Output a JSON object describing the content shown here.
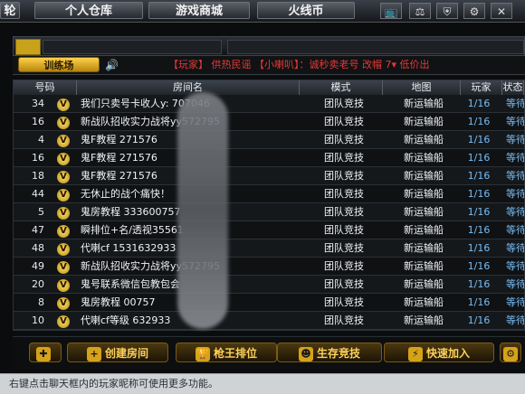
{
  "top": {
    "left_fragment": "轮",
    "tabs": [
      "个人仓库",
      "游戏商城",
      "火线币"
    ],
    "icons": [
      "tv-icon",
      "scale-icon",
      "shield-icon",
      "settings-icon",
      "close-icon"
    ]
  },
  "mode": {
    "button_label": "训练场",
    "marquee": "【玩家】 供热民谣 【小喇叭】：诚秒卖老号  改帽  7▾  低价出"
  },
  "table": {
    "headers": [
      "号码",
      "房间名",
      "模式",
      "地图",
      "玩家",
      "状态"
    ],
    "rows": [
      {
        "num": "34",
        "name": "我们只卖号卡收人y: 707046",
        "mode": "团队竞技",
        "map": "新运输船",
        "players": "1/16",
        "state": "等待"
      },
      {
        "num": "16",
        "name": "新战队招收实力战将yy572795",
        "mode": "团队竞技",
        "map": "新运输船",
        "players": "1/16",
        "state": "等待"
      },
      {
        "num": "4",
        "name": "鬼F教程 271576",
        "mode": "团队竞技",
        "map": "新运输船",
        "players": "1/16",
        "state": "等待"
      },
      {
        "num": "16",
        "name": "鬼F教程 271576",
        "mode": "团队竞技",
        "map": "新运输船",
        "players": "1/16",
        "state": "等待"
      },
      {
        "num": "18",
        "name": "鬼F教程 271576",
        "mode": "团队竞技",
        "map": "新运输船",
        "players": "1/16",
        "state": "等待"
      },
      {
        "num": "44",
        "name": "无休止的战个痛快！",
        "mode": "团队竞技",
        "map": "新运输船",
        "players": "1/16",
        "state": "等待"
      },
      {
        "num": "5",
        "name": "鬼房教程 333600757",
        "mode": "团队竞技",
        "map": "新运输船",
        "players": "1/16",
        "state": "等待"
      },
      {
        "num": "47",
        "name": "瞬排位+名/透视35561",
        "mode": "团队竞技",
        "map": "新运输船",
        "players": "1/16",
        "state": "等待"
      },
      {
        "num": "48",
        "name": "代喇cf 1531632933",
        "mode": "团队竞技",
        "map": "新运输船",
        "players": "1/16",
        "state": "等待"
      },
      {
        "num": "49",
        "name": "新战队招收实力战将yy572795",
        "mode": "团队竞技",
        "map": "新运输船",
        "players": "1/16",
        "state": "等待"
      },
      {
        "num": "20",
        "name": "鬼号联系微信包教包会",
        "mode": "团队竞技",
        "map": "新运输船",
        "players": "1/16",
        "state": "等待"
      },
      {
        "num": "8",
        "name": "鬼房教程 00757",
        "mode": "团队竞技",
        "map": "新运输船",
        "players": "1/16",
        "state": "等待"
      },
      {
        "num": "10",
        "name": "代喇cf等级 632933",
        "mode": "团队竞技",
        "map": "新运输船",
        "players": "1/16",
        "state": "等待"
      }
    ]
  },
  "footer": {
    "create_room": "创建房间",
    "rank": "枪王排位",
    "survival": "生存竞技",
    "quick_join": "快速加入"
  },
  "status": {
    "text": "右键点击聊天框内的玩家昵称可使用更多功能。"
  }
}
